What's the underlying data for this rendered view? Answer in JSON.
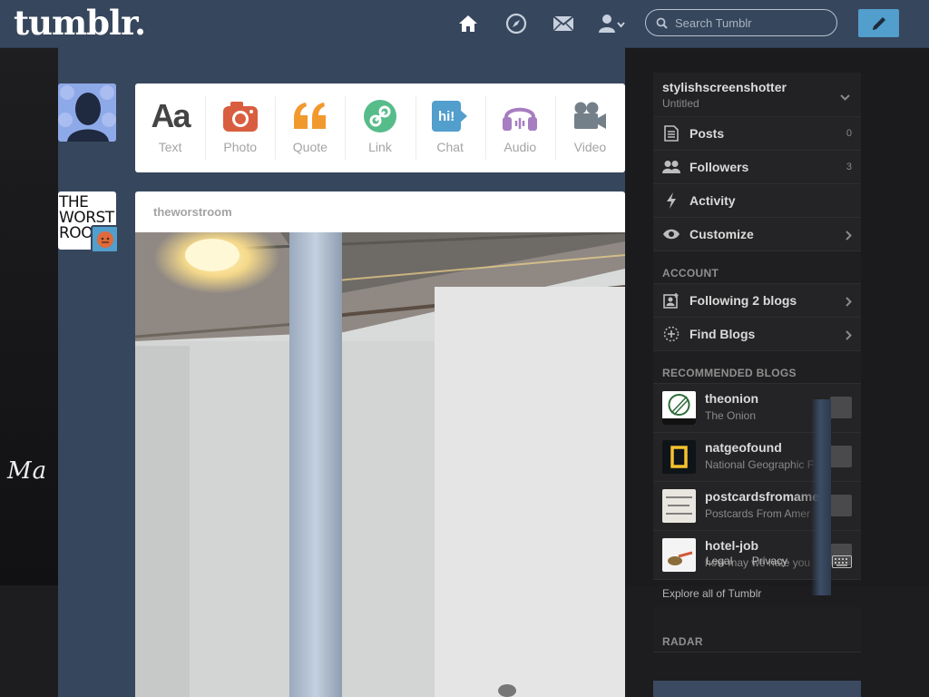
{
  "header": {
    "logo": "tumblr.",
    "search_placeholder": "Search Tumblr",
    "nav_icons": [
      "home-icon",
      "compass-icon",
      "mail-icon",
      "account-icon"
    ],
    "accent_color": "#36465d",
    "compose_color": "#529ecc"
  },
  "post_box": {
    "items": [
      {
        "label": "Text",
        "glyph": "Aa",
        "color": "#444444"
      },
      {
        "label": "Photo",
        "color": "#d95e40"
      },
      {
        "label": "Quote",
        "glyph": "66",
        "color": "#f2992e"
      },
      {
        "label": "Link",
        "color": "#56bc8a"
      },
      {
        "label": "Chat",
        "glyph": "hi!",
        "color": "#529ecc"
      },
      {
        "label": "Audio",
        "color": "#a77dc2"
      },
      {
        "label": "Video",
        "color": "#748089"
      }
    ]
  },
  "blog_avatar": {
    "lines": [
      "THE",
      "WORST",
      "ROO"
    ]
  },
  "post": {
    "blog_name": "theworstroom"
  },
  "sidebar": {
    "blog_name": "stylishscreenshotter",
    "blog_title": "Untitled",
    "rows": [
      {
        "label": "Posts",
        "count": "0"
      },
      {
        "label": "Followers",
        "count": "3"
      },
      {
        "label": "Activity"
      },
      {
        "label": "Customize"
      }
    ],
    "account_heading": "ACCOUNT",
    "account_rows": [
      {
        "label": "Following 2 blogs"
      },
      {
        "label": "Find Blogs"
      }
    ],
    "recommended_heading": "RECOMMENDED BLOGS",
    "recommended": [
      {
        "name": "theonion",
        "sub": "The Onion"
      },
      {
        "name": "natgeofound",
        "sub": "National Geographic F"
      },
      {
        "name": "postcardsfromamer",
        "sub": "Postcards From Amer"
      },
      {
        "name": "hotel-job",
        "sub": "how may we hate you"
      }
    ],
    "explore": "Explore all of Tumblr",
    "radar_heading": "RADAR"
  },
  "footer_overlay": {
    "items": [
      "Legal",
      "Privacy"
    ]
  }
}
